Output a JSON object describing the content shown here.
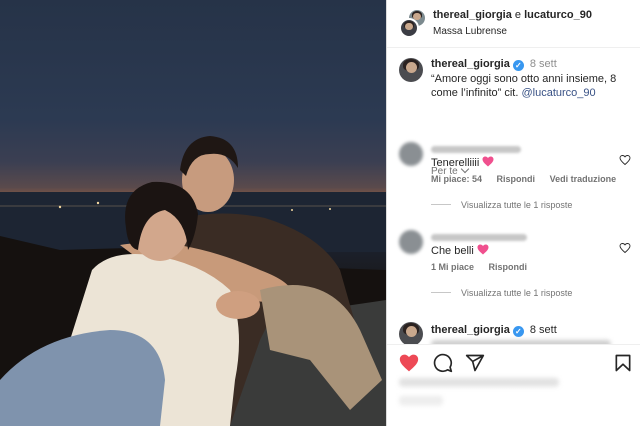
{
  "colors": {
    "verified": "#3897f0",
    "mention": "#385185",
    "like_red": "#ed4956",
    "muted": "#737373"
  },
  "photo": {
    "icon": "couple-photo"
  },
  "header": {
    "user1": "thereal_giorgia",
    "conjunction": "e",
    "user2": "lucaturco_90",
    "location": "Massa Lubrense"
  },
  "caption": {
    "username": "thereal_giorgia",
    "verified_icon": "verified-badge-icon",
    "time": "8 sett",
    "text": "“Amore oggi sono otto anni insieme, 8 come l’infinito” cit.",
    "mention": "@lucaturco_90"
  },
  "sort": {
    "label": "Per te"
  },
  "comments": [
    {
      "text": "Tenerelliiii",
      "likes": "Mi piace: 54",
      "reply": "Rispondi",
      "translate": "Vedi traduzione",
      "replies": "Visualizza tutte le 1 risposte"
    },
    {
      "text": "Che belli",
      "likes": "1 Mi piace",
      "reply": "Rispondi",
      "replies": "Visualizza tutte le 1 risposte"
    }
  ],
  "comment3": {
    "username": "thereal_giorgia",
    "time": "8 sett"
  },
  "actions": {
    "like_icon": "heart-filled-icon",
    "comment_icon": "comment-icon",
    "share_icon": "share-icon",
    "save_icon": "bookmark-icon"
  }
}
